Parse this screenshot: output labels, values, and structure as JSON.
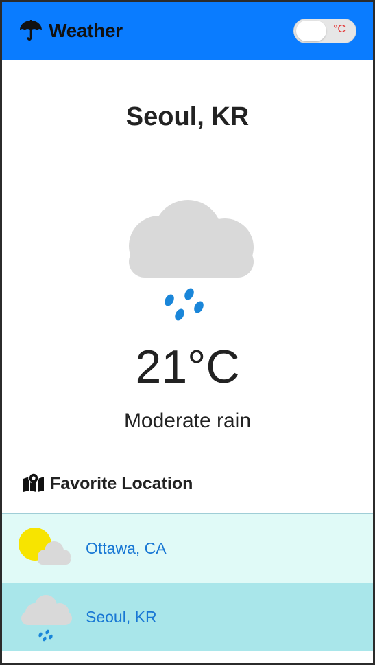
{
  "header": {
    "title": "Weather",
    "icon": "umbrella-icon",
    "unit_toggle_label": "°C"
  },
  "current": {
    "city": "Seoul, KR",
    "icon": "cloud-rain-icon",
    "temperature": "21°C",
    "description": "Moderate rain"
  },
  "favorites": {
    "heading": "Favorite Location",
    "heading_icon": "map-marker-icon",
    "items": [
      {
        "label": "Ottawa, CA",
        "icon": "sun-cloud-icon"
      },
      {
        "label": "Seoul, KR",
        "icon": "cloud-rain-icon"
      }
    ]
  },
  "colors": {
    "header_bg": "#0a7cff",
    "cloud": "#d9d9d9",
    "rain": "#1a86d9",
    "sun": "#f7e400",
    "favorite_link": "#1877d4",
    "favorite_bg_1": "#e0faf7",
    "favorite_bg_2": "#a9e6ea",
    "toggle_label": "#e33a3a"
  }
}
